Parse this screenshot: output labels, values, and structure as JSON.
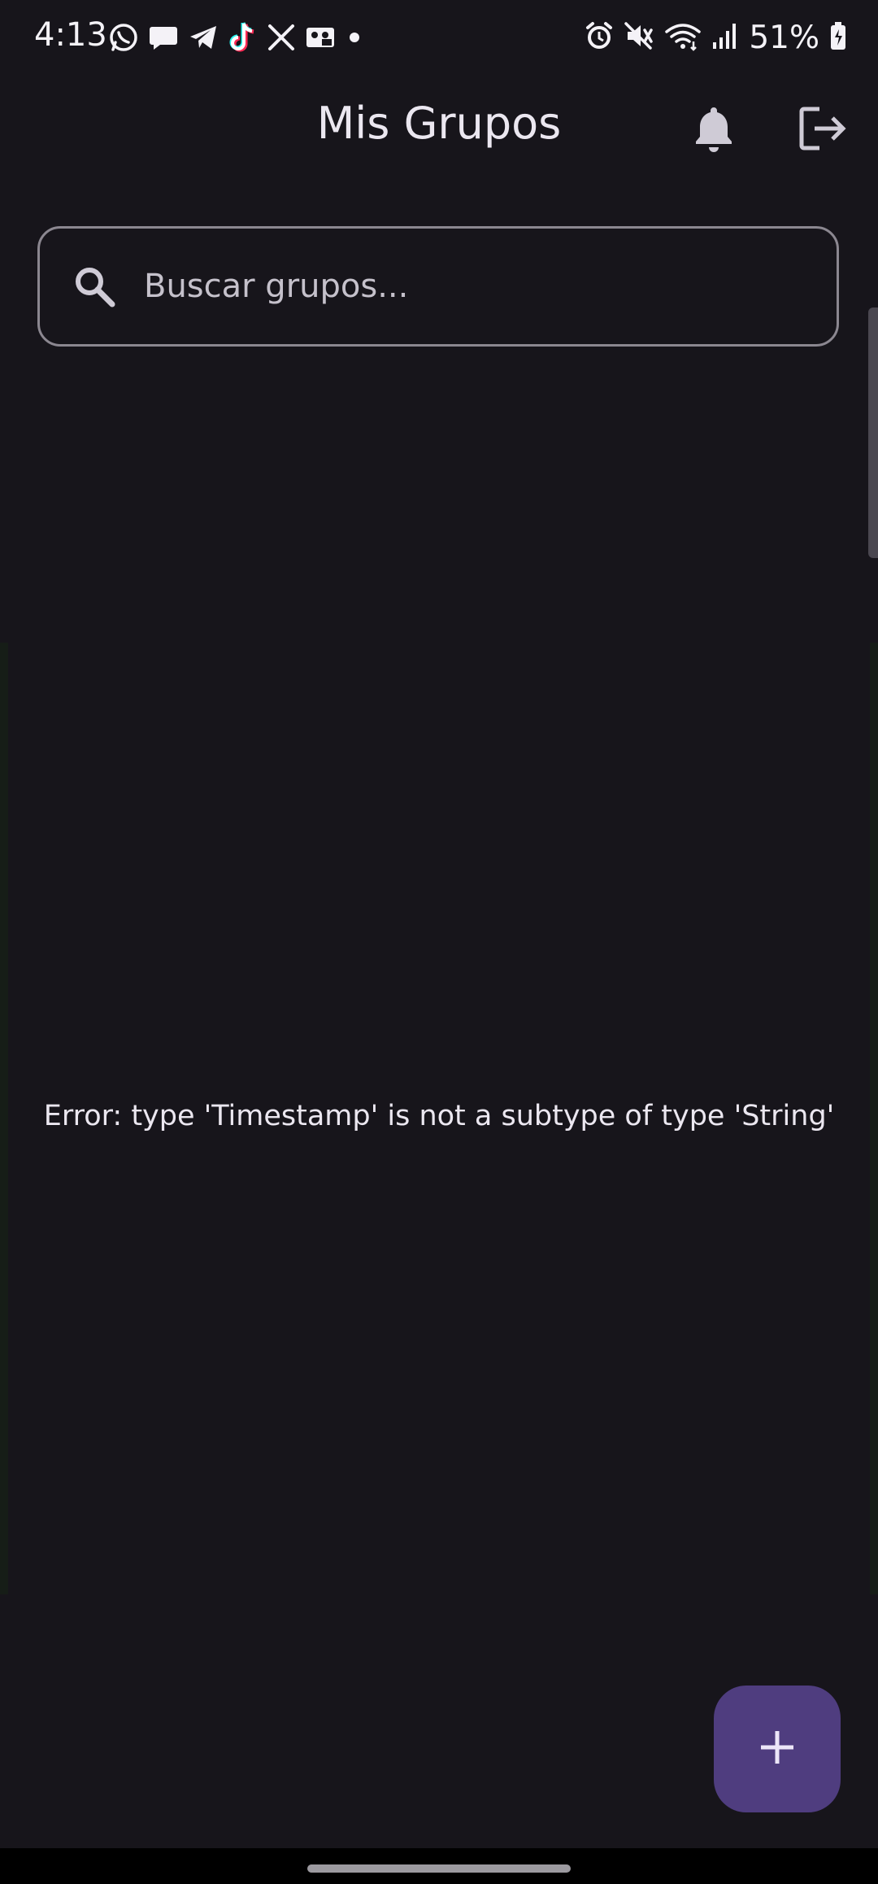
{
  "status_bar": {
    "time": "4:13",
    "battery": "51%",
    "notification_icons": [
      "whatsapp-icon",
      "message-icon",
      "telegram-icon",
      "tiktok-icon",
      "x-icon",
      "voicemail-icon",
      "dot-icon"
    ],
    "system_icons": [
      "alarm-icon",
      "mute-icon",
      "wifi-icon",
      "signal-icon",
      "battery-charging-icon"
    ]
  },
  "app_bar": {
    "title": "Mis Grupos",
    "actions": [
      "bell-icon",
      "logout-icon"
    ]
  },
  "search": {
    "placeholder": "Buscar grupos...",
    "value": "",
    "icon": "search-icon"
  },
  "content": {
    "error_message": "Error: type 'Timestamp' is not a subtype of type 'String'"
  },
  "fab": {
    "icon": "plus-icon"
  },
  "colors": {
    "background": "#17151b",
    "text": "#ebe7f0",
    "fab": "#4f3d7f",
    "outline": "#8b8790"
  }
}
